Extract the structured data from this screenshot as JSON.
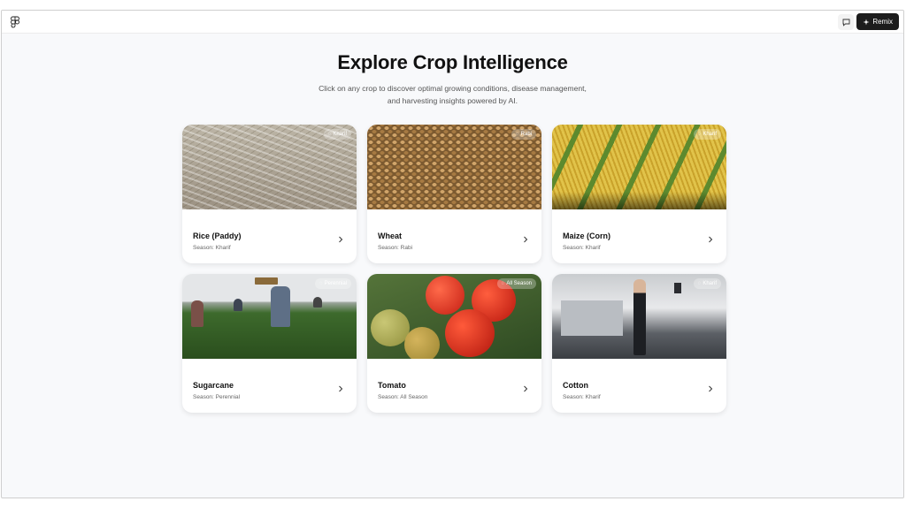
{
  "header": {
    "comment_icon": "comment-icon",
    "remix_label": "Remix",
    "remix_icon": "sparkle-icon"
  },
  "page": {
    "title": "Explore Crop Intelligence",
    "subtitle_line1": "Click on any crop to discover optimal growing conditions, disease management,",
    "subtitle_line2": "and harvesting insights powered by AI."
  },
  "crops": [
    {
      "name": "Rice (Paddy)",
      "season": "Season: Kharif",
      "badge": "Kharif",
      "photo": "rice"
    },
    {
      "name": "Wheat",
      "season": "Season: Rabi",
      "badge": "Rabi",
      "photo": "wheat"
    },
    {
      "name": "Maize (Corn)",
      "season": "Season: Kharif",
      "badge": "Kharif",
      "photo": "maize"
    },
    {
      "name": "Sugarcane",
      "season": "Season: Perennial",
      "badge": "Perennial",
      "photo": "sugarcane"
    },
    {
      "name": "Tomato",
      "season": "Season: All Season",
      "badge": "All Season",
      "photo": "tomato"
    },
    {
      "name": "Cotton",
      "season": "Season: Kharif",
      "badge": "Kharif",
      "photo": "cotton"
    }
  ],
  "colors": {
    "background": "#f8f9fb",
    "card": "#ffffff",
    "remix_button": "#1c1c1c"
  }
}
